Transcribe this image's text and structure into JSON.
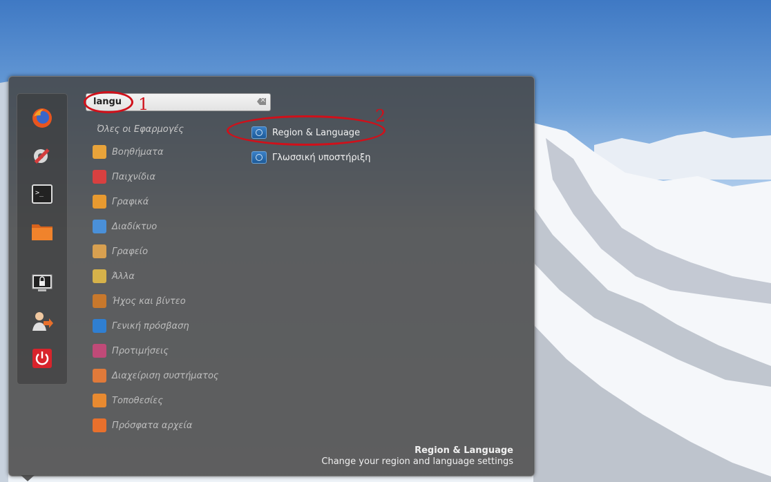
{
  "search": {
    "value": "langu"
  },
  "favorites": [
    {
      "name": "firefox-icon"
    },
    {
      "name": "system-settings-icon"
    },
    {
      "name": "terminal-icon"
    },
    {
      "name": "files-icon"
    },
    {
      "name": "lock-screen-icon"
    },
    {
      "name": "logout-icon"
    },
    {
      "name": "shutdown-icon"
    }
  ],
  "categories": {
    "all": "Όλες οι Εφαρμογές",
    "items": [
      {
        "label": "Βοηθήματα",
        "icon": "accessories-icon",
        "color": "#e8a33a"
      },
      {
        "label": "Παιχνίδια",
        "icon": "games-icon",
        "color": "#d84040"
      },
      {
        "label": "Γραφικά",
        "icon": "graphics-icon",
        "color": "#e89a30"
      },
      {
        "label": "Διαδίκτυο",
        "icon": "internet-icon",
        "color": "#4a90d9"
      },
      {
        "label": "Γραφείο",
        "icon": "office-icon",
        "color": "#d8a050"
      },
      {
        "label": "Άλλα",
        "icon": "other-icon",
        "color": "#d6b24a"
      },
      {
        "label": "Ήχος και βίντεο",
        "icon": "multimedia-icon",
        "color": "#c8782c"
      },
      {
        "label": "Γενική πρόσβαση",
        "icon": "accessibility-icon",
        "color": "#2f7fd2"
      },
      {
        "label": "Προτιμήσεις",
        "icon": "preferences-icon",
        "color": "#c04a78"
      },
      {
        "label": "Διαχείριση συστήματος",
        "icon": "administration-icon",
        "color": "#e07a3a"
      },
      {
        "label": "Τοποθεσίες",
        "icon": "places-icon",
        "color": "#e88a30"
      },
      {
        "label": "Πρόσφατα αρχεία",
        "icon": "recent-files-icon",
        "color": "#e8702c"
      }
    ]
  },
  "results": [
    {
      "label": "Region & Language"
    },
    {
      "label": "Γλωσσική υποστήριξη"
    }
  ],
  "description": {
    "title": "Region & Language",
    "text": "Change your region and language settings"
  },
  "annotations": {
    "one": "1",
    "two": "2"
  },
  "colors": {
    "annotation": "#d0101a",
    "panel": "#464646"
  }
}
